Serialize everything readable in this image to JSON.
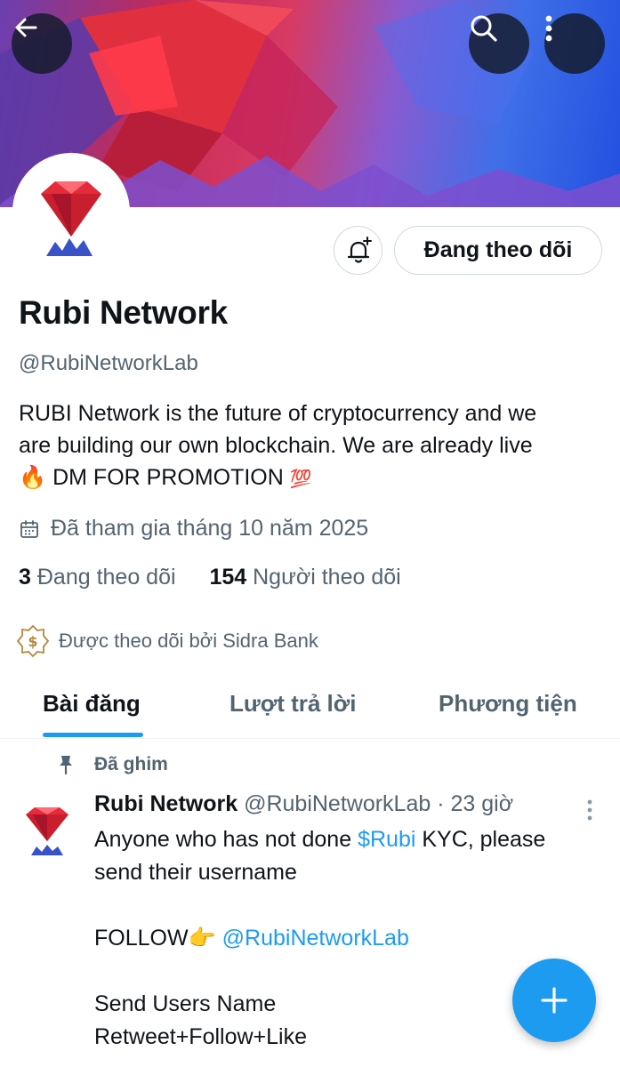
{
  "header": {
    "back_icon": "arrow-left-icon",
    "search_icon": "search-icon",
    "more_icon": "more-vertical-icon"
  },
  "profile": {
    "display_name": "Rubi Network",
    "handle": "@RubiNetworkLab",
    "bio_line1": "RUBI Network is the future of cryptocurrency and we",
    "bio_line2": "are building our own blockchain. We are already live",
    "bio_fire": "🔥",
    "bio_line3": "DM FOR PROMOTION",
    "bio_100": "💯",
    "joined": "Đã tham gia tháng 10 năm 2025",
    "following_count": "3",
    "following_label": "Đang theo dõi",
    "followers_count": "154",
    "followers_label": "Người theo dõi",
    "followed_by": "Được theo dõi bởi Sidra Bank",
    "follow_button": "Đang theo dõi"
  },
  "tabs": [
    {
      "label": "Bài đăng",
      "active": true
    },
    {
      "label": "Lượt trả lời",
      "active": false
    },
    {
      "label": "Phương tiện",
      "active": false
    }
  ],
  "pinned_tweet": {
    "pinned_label": "Đã ghim",
    "author_name": "Rubi Network",
    "author_handle": "@RubiNetworkLab",
    "separator": "·",
    "time": "23 giờ",
    "line1_prefix": "Anyone who has not done",
    "cashtag": "$Rubi",
    "line1_suffix": "KYC, please",
    "line2": "send their username",
    "follow_prefix": "FOLLOW👉",
    "mention": "@RubiNetworkLab",
    "line4": "Send Users Name",
    "line5": "Retweet+Follow+Like"
  },
  "fab": {
    "icon": "plus-icon"
  },
  "colors": {
    "accent": "#1d9bf0",
    "text_primary": "#0f1419",
    "text_secondary": "#536471",
    "border": "#cfd9de"
  }
}
